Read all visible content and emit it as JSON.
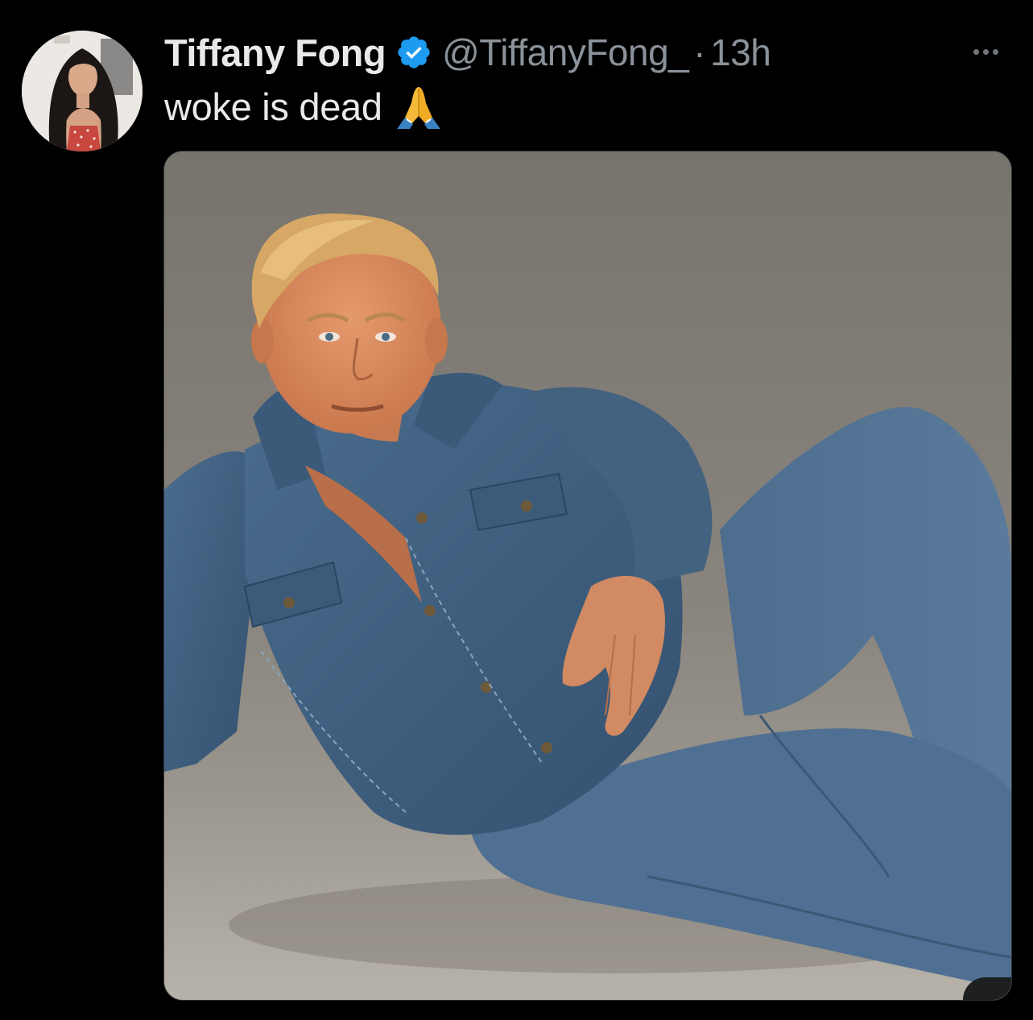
{
  "post": {
    "author": {
      "display_name": "Tiffany Fong",
      "handle": "@TiffanyFong_",
      "verified": true,
      "avatar_icon": "avatar-portrait"
    },
    "separator": "·",
    "time_ago": "13h",
    "text": "woke is dead",
    "emoji_icon": "folded-hands-icon",
    "more_icon": "more-options-icon"
  },
  "colors": {
    "background": "#000000",
    "primary_text": "#e7e9ea",
    "secondary_text": "#8b9299",
    "verified_blue": "#1d9bf0",
    "media_backdrop": "#7c7a74",
    "denim": "#3f5f7e"
  }
}
